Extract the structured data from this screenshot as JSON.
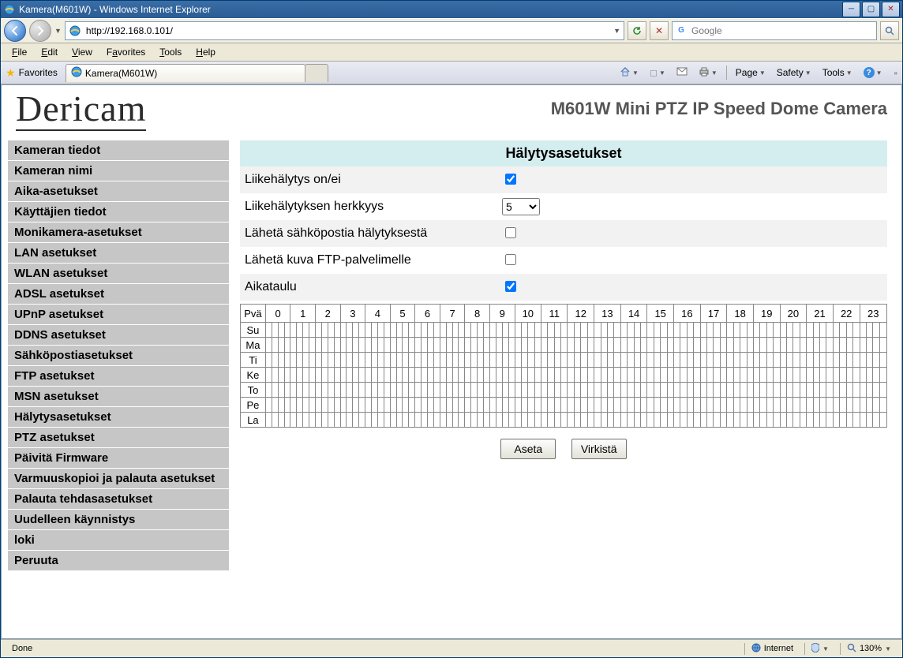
{
  "window_title": "Kamera(M601W) - Windows Internet Explorer",
  "address_bar": "http://192.168.0.101/",
  "search_placeholder": "Google",
  "menus": {
    "file": "File",
    "edit": "Edit",
    "view": "View",
    "favorites": "Favorites",
    "tools": "Tools",
    "help": "Help"
  },
  "favorites_label": "Favorites",
  "tab_title": "Kamera(M601W)",
  "cmd": {
    "page": "Page",
    "safety": "Safety",
    "tools": "Tools"
  },
  "brand": "Dericam",
  "model_header": "M601W Mini PTZ IP Speed Dome Camera",
  "sidebar": [
    "Kameran tiedot",
    "Kameran nimi",
    "Aika-asetukset",
    "Käyttäjien tiedot",
    "Monikamera-asetukset",
    "LAN asetukset",
    "WLAN asetukset",
    "ADSL asetukset",
    "UPnP asetukset",
    "DDNS asetukset",
    "Sähköpostiasetukset",
    "FTP asetukset",
    "MSN asetukset",
    "Hälytysasetukset",
    "PTZ asetukset",
    "Päivitä Firmware",
    "Varmuuskopioi ja palauta asetukset",
    "Palauta tehdasasetukset",
    "Uudelleen käynnistys",
    "loki",
    "Peruuta"
  ],
  "panel_title": "Hälytysasetukset",
  "form": {
    "motion_label": "Liikehälytys on/ei",
    "motion_checked": true,
    "sens_label": "Liikehälytyksen herkkyys",
    "sens_value": "5",
    "mail_label": "Lähetä sähköpostia hälytyksestä",
    "mail_checked": false,
    "ftp_label": "Lähetä kuva FTP-palvelimelle",
    "ftp_checked": false,
    "sched_label": "Aikataulu",
    "sched_checked": true
  },
  "sched_day_header": "Pvä",
  "sched_hours": [
    "0",
    "1",
    "2",
    "3",
    "4",
    "5",
    "6",
    "7",
    "8",
    "9",
    "10",
    "11",
    "12",
    "13",
    "14",
    "15",
    "16",
    "17",
    "18",
    "19",
    "20",
    "21",
    "22",
    "23"
  ],
  "sched_days": [
    "Su",
    "Ma",
    "Ti",
    "Ke",
    "To",
    "Pe",
    "La"
  ],
  "buttons": {
    "set": "Aseta",
    "refresh": "Virkistä"
  },
  "status": {
    "done": "Done",
    "zone": "Internet",
    "protected": "Protected Mode: ?",
    "zoom": "130%"
  }
}
